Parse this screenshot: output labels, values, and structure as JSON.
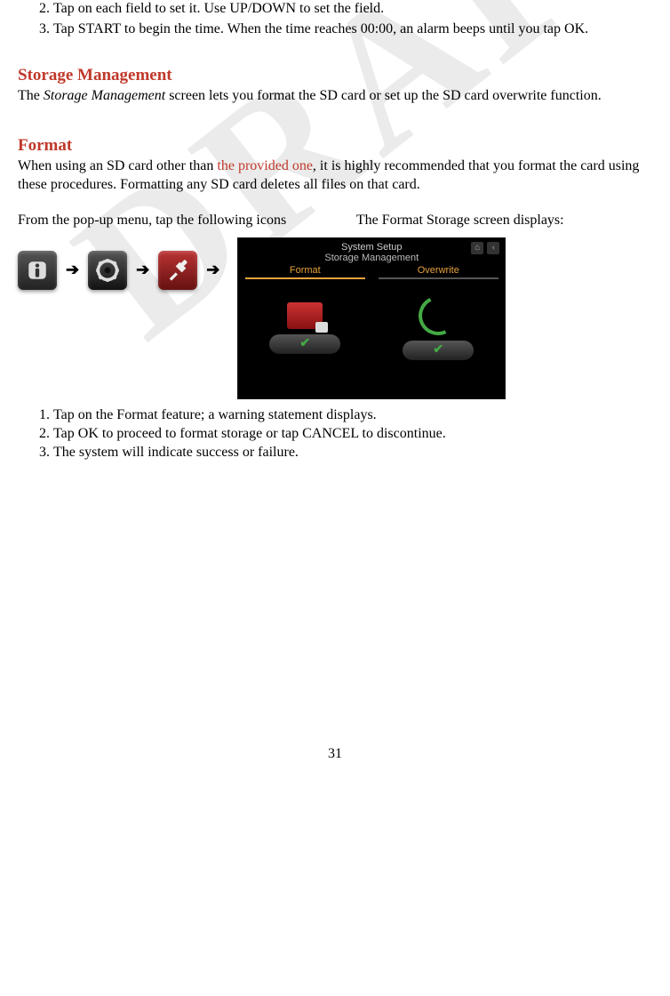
{
  "watermark": "DRAFT",
  "initial_list": {
    "start": 2,
    "items": [
      "Tap on each field to set it. Use UP/DOWN to set the field.",
      "Tap START to begin the time. When the time reaches 00:00, an alarm beeps until you tap OK."
    ]
  },
  "storage": {
    "heading": "Storage Management",
    "body_prefix": "The ",
    "body_italic": "Storage Management",
    "body_suffix": " screen lets you format the SD card or set up the SD card overwrite function."
  },
  "format": {
    "heading": "Format",
    "body_prefix": "When using an SD card other than ",
    "body_red": "the provided one",
    "body_suffix": ", it is highly recommended that you format the card using these procedures. Formatting any SD card deletes all files on that card."
  },
  "twocol": {
    "left": "From the pop-up menu, tap the following icons",
    "right": "The Format Storage screen displays:"
  },
  "arrows": [
    "➔",
    "➔",
    "➔"
  ],
  "screenshot": {
    "title": "System Setup",
    "subtitle": "Storage Management",
    "tab1": "Format",
    "tab2": "Overwrite"
  },
  "steps": {
    "items": [
      "Tap on the Format feature; a warning statement displays.",
      "Tap OK to proceed to format storage or tap CANCEL to discontinue.",
      "The system will indicate success or failure."
    ]
  },
  "page_number": "31"
}
